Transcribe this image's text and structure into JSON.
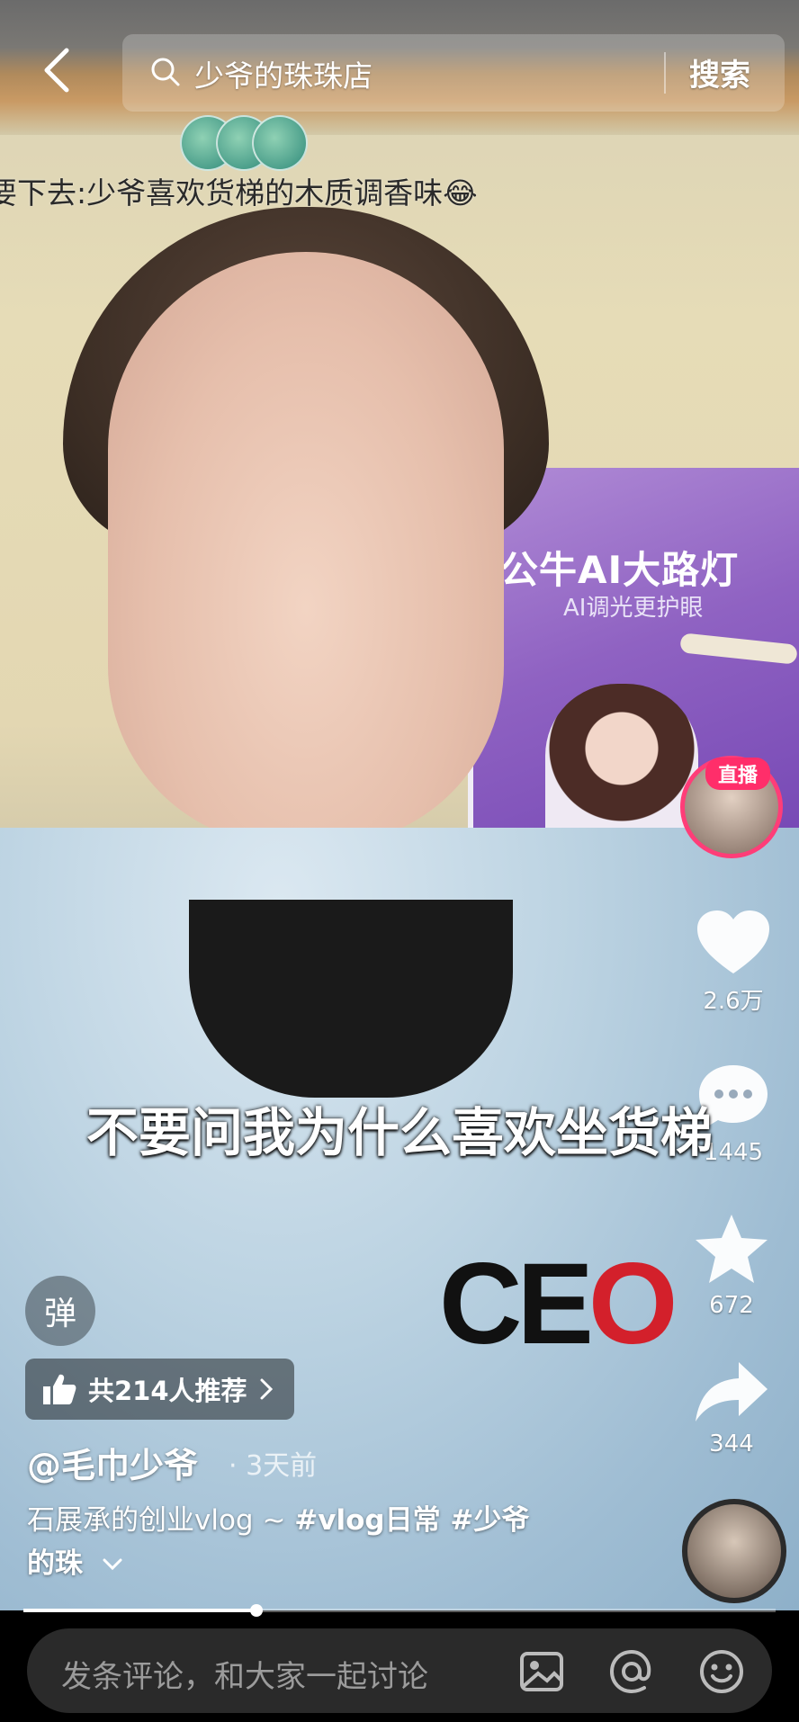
{
  "search": {
    "query": "少爷的珠珠店",
    "button_label": "搜索"
  },
  "danmaku": {
    "text": "要下去:少爷喜欢货梯的木质调香味😂"
  },
  "poster": {
    "title": "公牛AI大路灯",
    "subtitle": "AI调光更护眼"
  },
  "video": {
    "subtitle": "不要问我为什么喜欢坐货梯",
    "shirt_logo": "CE",
    "shirt_logo_o": "O"
  },
  "live": {
    "badge": "直播"
  },
  "actions": {
    "like_count": "2.6万",
    "comment_count": "1445",
    "favorite_count": "672",
    "share_count": "344"
  },
  "danmu_toggle": "弹",
  "recommend": {
    "label": "共214人推荐"
  },
  "post": {
    "author": "@毛巾少爷",
    "time": "· 3天前",
    "desc_plain": "石展承的创业vlog ~ ",
    "tag1": "#vlog日常",
    "tag2": " #少爷",
    "desc_more": "的珠"
  },
  "progress": {
    "fraction": 0.31
  },
  "comment": {
    "placeholder": "发条评论，和大家一起讨论"
  },
  "colors": {
    "live_ring": "#ff3d78",
    "ceo_red": "#d3202b"
  },
  "icons": [
    "back-arrow-icon",
    "search-icon",
    "heart-icon",
    "comment-icon",
    "star-icon",
    "share-icon",
    "thumb-up-icon",
    "chevron-right-icon",
    "chevron-down-icon",
    "image-icon",
    "at-icon",
    "emoji-icon"
  ]
}
